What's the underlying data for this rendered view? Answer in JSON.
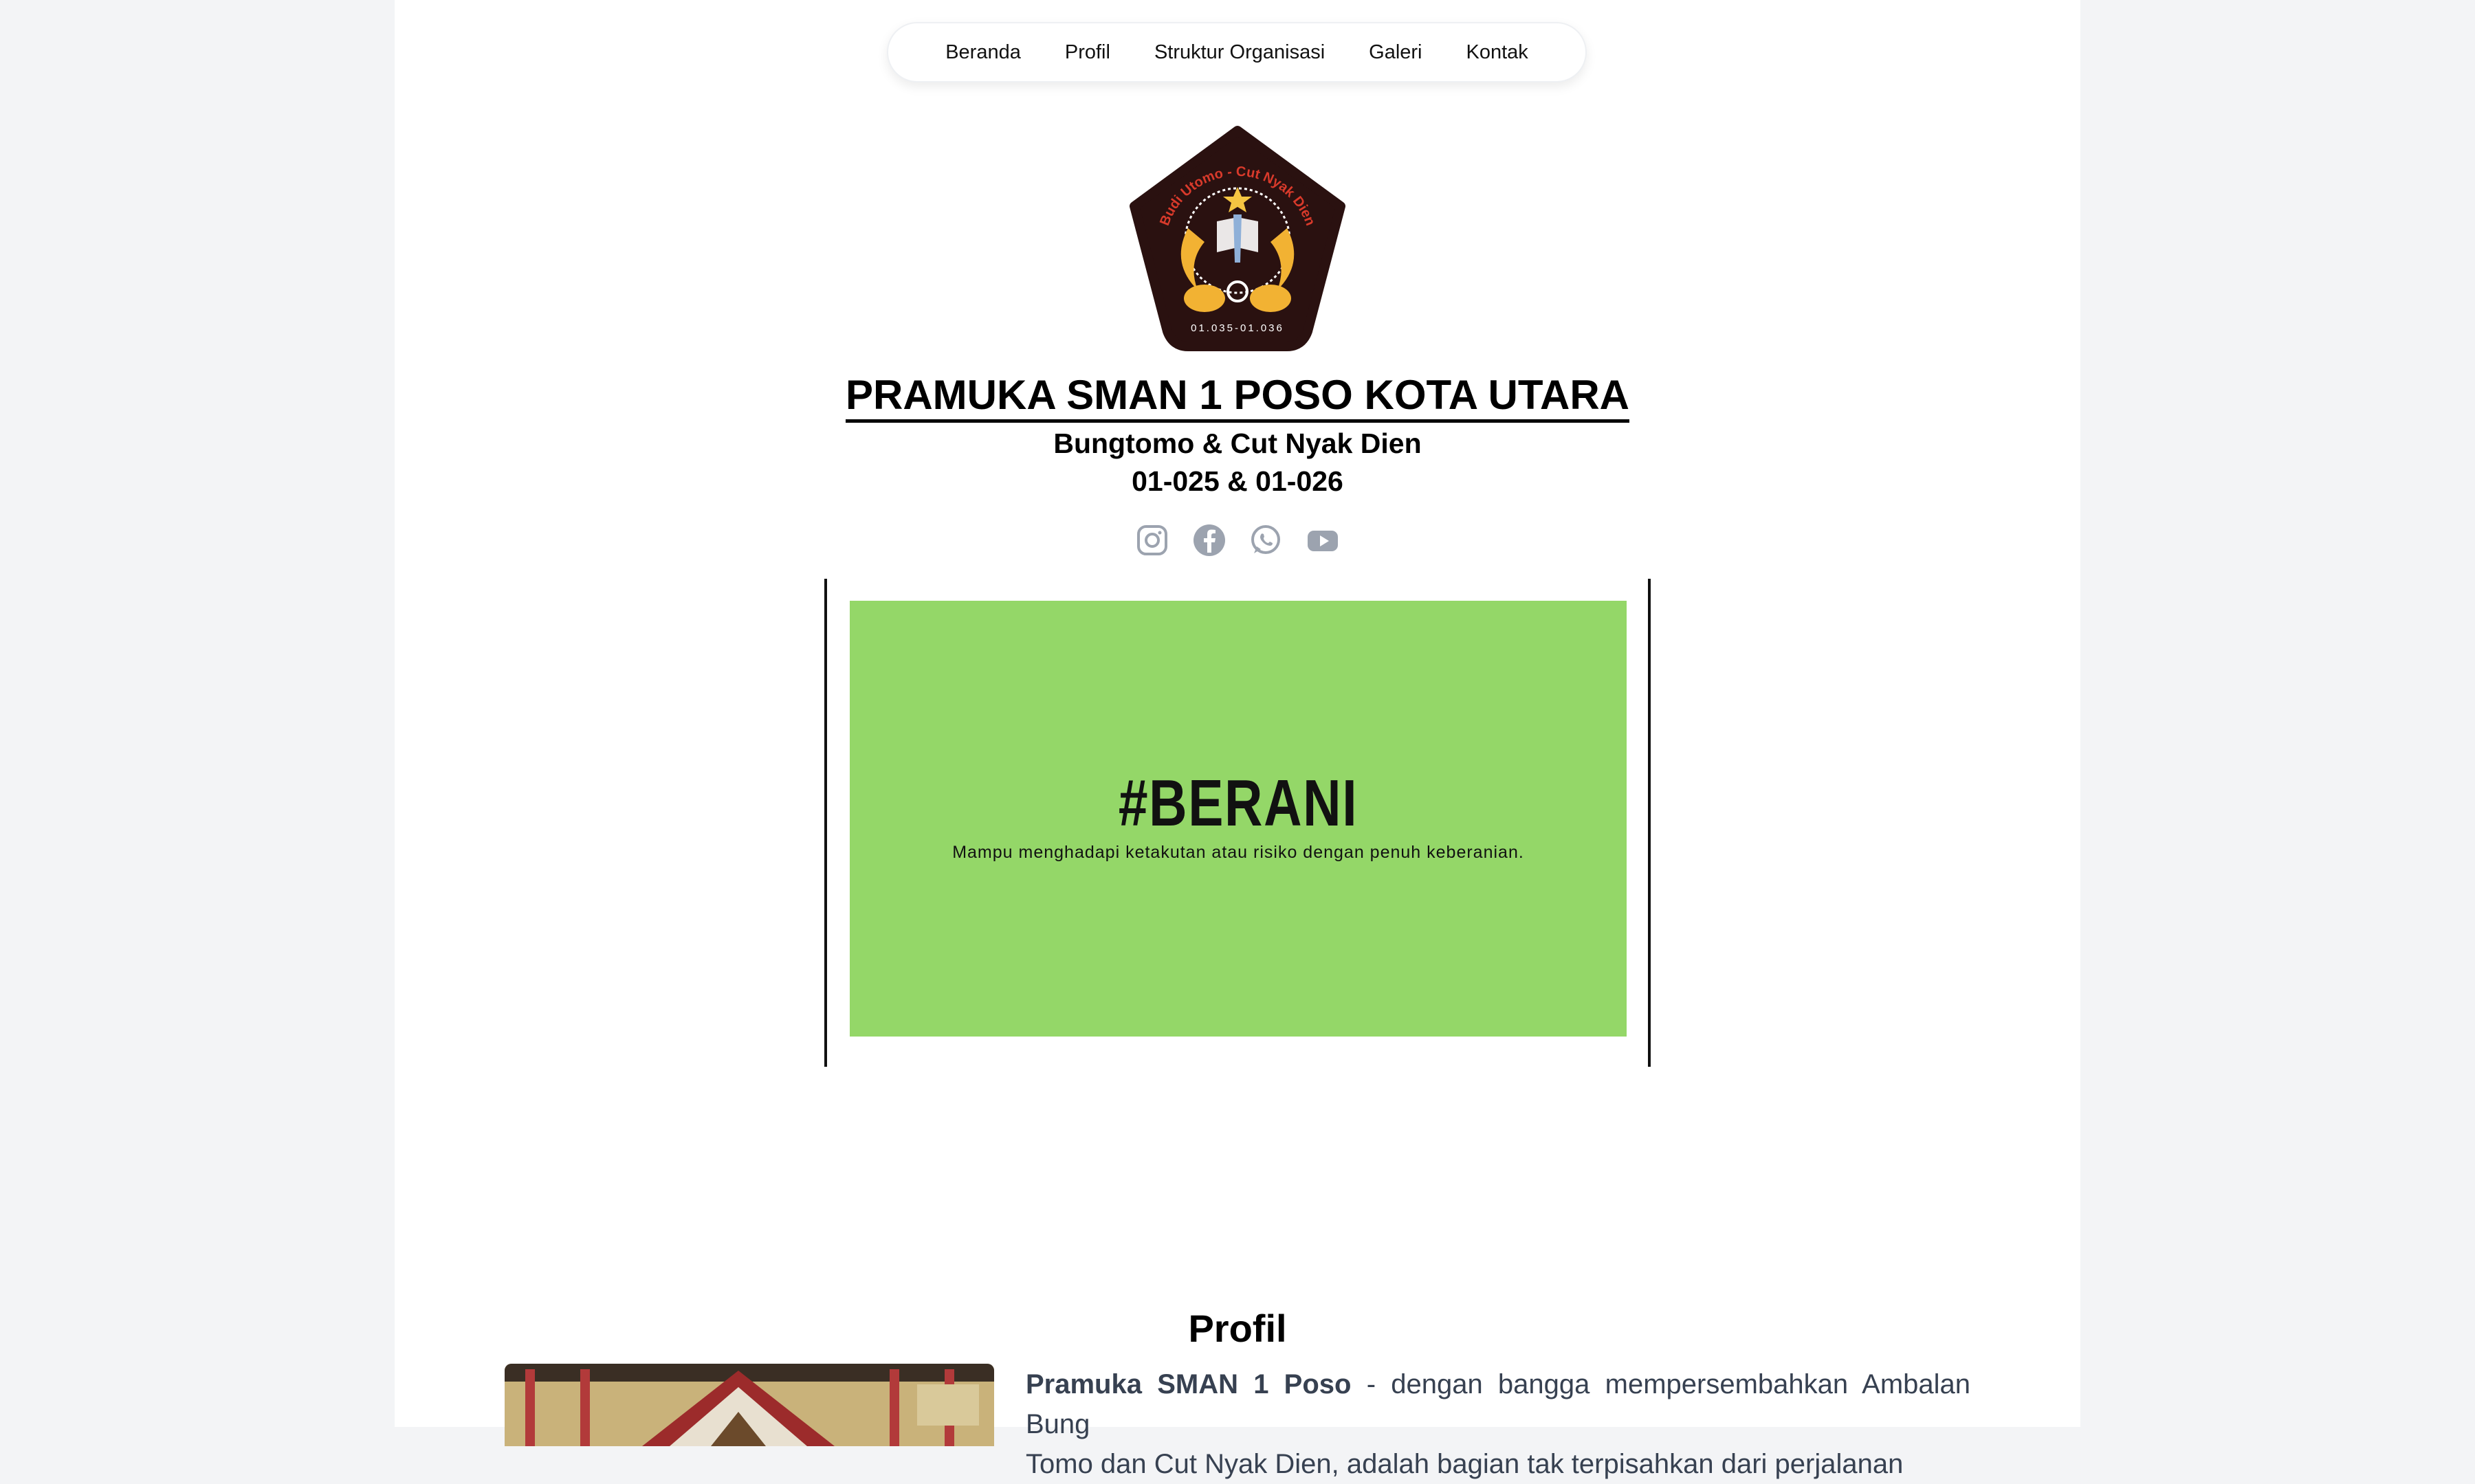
{
  "nav": {
    "items": [
      {
        "label": "Beranda"
      },
      {
        "label": "Profil"
      },
      {
        "label": "Struktur Organisasi"
      },
      {
        "label": "Galeri"
      },
      {
        "label": "Kontak"
      }
    ]
  },
  "header": {
    "title": "PRAMUKA SMAN 1 POSO KOTA UTARA",
    "subtitle": "Bungtomo & Cut Nyak Dien",
    "code": "01-025 & 01-026",
    "logo": {
      "ring_text": "Budi Utomo - Cut Nyak Dien",
      "code_text": "01.035-01.036"
    }
  },
  "social": {
    "icons": [
      "instagram-icon",
      "facebook-icon",
      "whatsapp-icon",
      "youtube-icon"
    ]
  },
  "banner": {
    "title": "#BERANI",
    "subtitle": "Mampu menghadapi ketakutan atau risiko dengan penuh keberanian.",
    "color": "#94d768"
  },
  "profil": {
    "heading": "Profil",
    "lead": "Pramuka SMAN 1 Poso",
    "text_line1": " - dengan bangga mempersembahkan Ambalan Bung",
    "text_line2": "Tomo dan Cut Nyak Dien, adalah bagian tak terpisahkan dari perjalanan"
  }
}
